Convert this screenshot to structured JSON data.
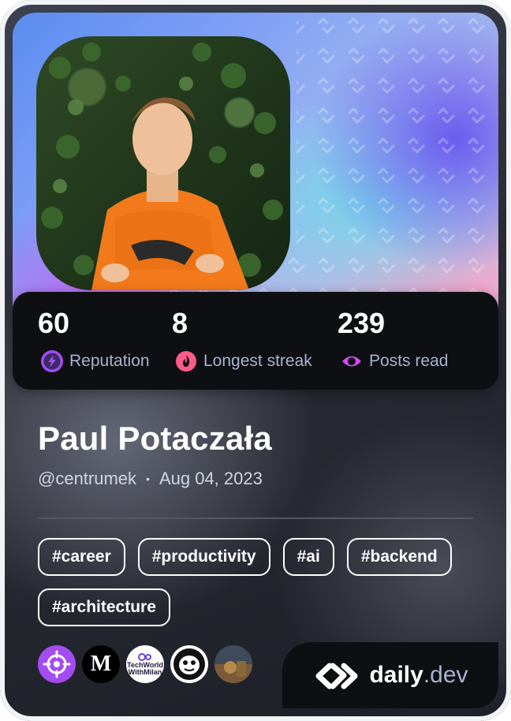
{
  "profile": {
    "name": "Paul Potaczała",
    "handle": "@centrumek",
    "separator": "•",
    "joined": "Aug 04, 2023"
  },
  "stats": [
    {
      "value": "60",
      "label": "Reputation",
      "icon": "bolt-icon",
      "color": "#a34cf2"
    },
    {
      "value": "8",
      "label": "Longest streak",
      "icon": "flame-icon",
      "color": "#ff5a8a"
    },
    {
      "value": "239",
      "label": "Posts read",
      "icon": "eye-icon",
      "color": "#d24cf2"
    }
  ],
  "tags": [
    "#career",
    "#productivity",
    "#ai",
    "#backend",
    "#architecture"
  ],
  "sources": [
    {
      "icon": "target-icon",
      "bg": "#a34cf2"
    },
    {
      "icon": "medium-icon",
      "bg": "#000000",
      "letter": "M"
    },
    {
      "icon": "techworld-with-milan-icon",
      "bg": "#ffffff",
      "line1": "TechWorld",
      "line2": "WithMilan"
    },
    {
      "icon": "character-logo-icon",
      "bg": "#ffffff"
    },
    {
      "icon": "photo-logo-icon",
      "bg": "#5a4a3a"
    }
  ],
  "brand": {
    "name": "daily",
    "tld": ".dev"
  },
  "colors": {
    "stats_bg": "#0e0f13",
    "label": "#a8b3cf",
    "accent_purple": "#a34cf2",
    "accent_pink": "#ff5a8a"
  }
}
